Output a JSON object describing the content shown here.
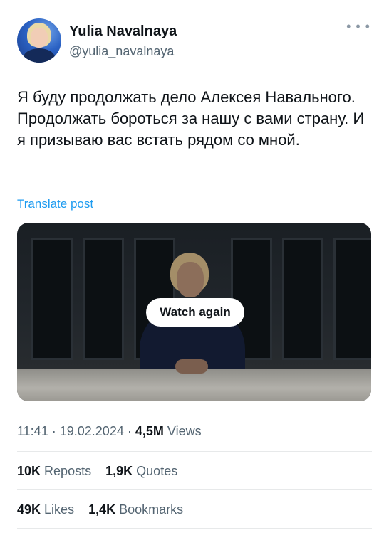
{
  "author": {
    "display_name": "Yulia Navalnaya",
    "handle": "@yulia_navalnaya",
    "more_icon": "more-horizontal-icon"
  },
  "post": {
    "text": "Я буду продолжать дело Алексея Навального. Продолжать бороться за нашу с вами страну. И я призываю вас встать рядом со мной.",
    "translate_label": "Translate post"
  },
  "media": {
    "button_label": "Watch again"
  },
  "meta": {
    "time": "11:41",
    "date": "19.02.2024",
    "separator": "·",
    "views_count": "4,5M",
    "views_label": "Views"
  },
  "stats": {
    "reposts_count": "10K",
    "reposts_label": "Reposts",
    "quotes_count": "1,9K",
    "quotes_label": "Quotes",
    "likes_count": "49K",
    "likes_label": "Likes",
    "bookmarks_count": "1,4K",
    "bookmarks_label": "Bookmarks"
  },
  "colors": {
    "link": "#1d9bf0",
    "text_primary": "#0f1419",
    "text_secondary": "#536471",
    "divider": "#e7e9ea"
  }
}
